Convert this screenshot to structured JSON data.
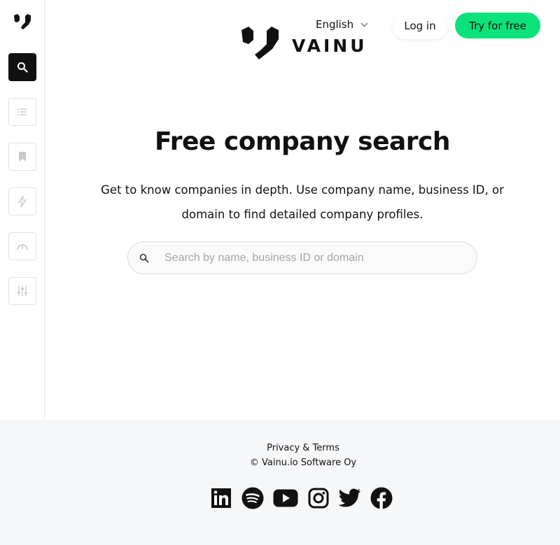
{
  "header": {
    "language": "English",
    "login_label": "Log in",
    "try_label": "Try for free",
    "brand_name": "VAINU",
    "accent_color": "#0ce27b"
  },
  "sidebar": {
    "items": [
      {
        "icon": "search-icon",
        "active": true
      },
      {
        "icon": "list-icon",
        "active": false
      },
      {
        "icon": "bookmark-icon",
        "active": false
      },
      {
        "icon": "lightning-icon",
        "active": false
      },
      {
        "icon": "gauge-icon",
        "active": false
      },
      {
        "icon": "sliders-icon",
        "active": false
      }
    ]
  },
  "main": {
    "title": "Free company search",
    "subtitle": "Get to know companies in depth. Use company name, business ID, or domain to find detailed company profiles.",
    "search_placeholder": "Search by name, business ID or domain",
    "search_value": ""
  },
  "footer": {
    "link_label": "Privacy & Terms",
    "copyright": "© Vainu.io Software Oy",
    "socials": [
      "linkedin-icon",
      "spotify-icon",
      "youtube-icon",
      "instagram-icon",
      "twitter-icon",
      "facebook-icon"
    ]
  }
}
